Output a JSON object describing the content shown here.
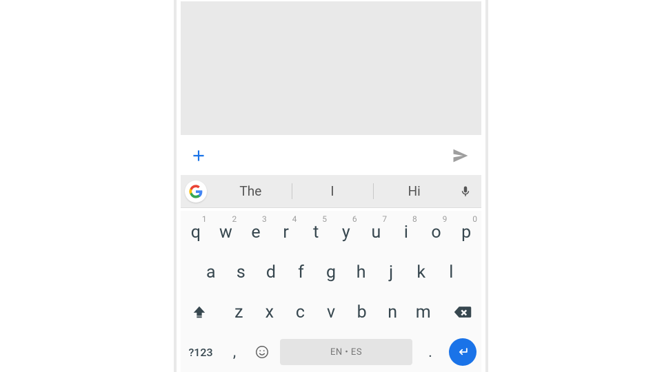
{
  "suggestions": {
    "s0": "The",
    "s1": "I",
    "s2": "Hi"
  },
  "row1": {
    "k0": "q",
    "k1": "w",
    "k2": "e",
    "k3": "r",
    "k4": "t",
    "k5": "y",
    "k6": "u",
    "k7": "i",
    "k8": "o",
    "k9": "p",
    "h0": "1",
    "h1": "2",
    "h2": "3",
    "h3": "4",
    "h4": "5",
    "h5": "6",
    "h6": "7",
    "h7": "8",
    "h8": "9",
    "h9": "0"
  },
  "row2": {
    "k0": "a",
    "k1": "s",
    "k2": "d",
    "k3": "f",
    "k4": "g",
    "k5": "h",
    "k6": "j",
    "k7": "k",
    "k8": "l"
  },
  "row3": {
    "k0": "z",
    "k1": "x",
    "k2": "c",
    "k3": "v",
    "k4": "b",
    "k5": "n",
    "k6": "m"
  },
  "row4": {
    "symbols": "?123",
    "comma": ",",
    "period": ".",
    "space_label": "EN • ES"
  },
  "colors": {
    "accent": "#1a73e8"
  }
}
